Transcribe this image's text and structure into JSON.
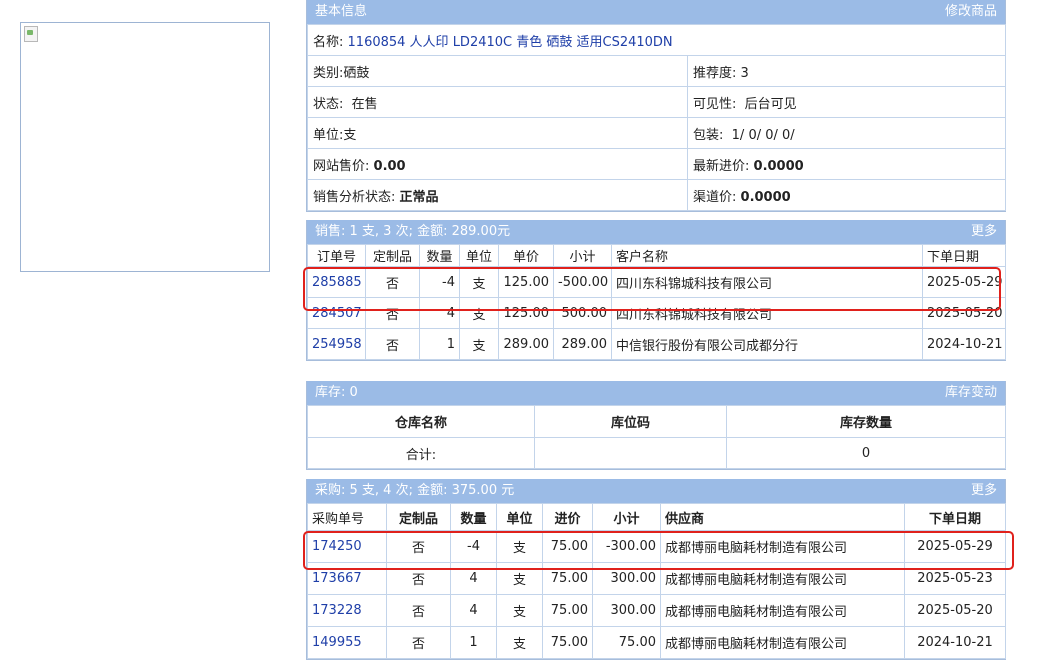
{
  "basic": {
    "header": "基本信息",
    "edit_link": "修改商品",
    "name_label": "名称:",
    "name_value": "1160854 人人印 LD2410C 青色 硒鼓 适用CS2410DN",
    "category_label": "类别:",
    "category_value": "硒鼓",
    "recommend_label": "推荐度:",
    "recommend_value": "3",
    "status_label": "状态:",
    "status_value": "在售",
    "visibility_label": "可见性:",
    "visibility_value": "后台可见",
    "unit_label": "单位:",
    "unit_value": "支",
    "package_label": "包装:",
    "package_value": "1/ 0/ 0/ 0/",
    "web_price_label": "网站售价:",
    "web_price_value": "0.00",
    "latest_cost_label": "最新进价:",
    "latest_cost_value": "0.0000",
    "analysis_label": "销售分析状态:",
    "analysis_value": "正常品",
    "channel_price_label": "渠道价:",
    "channel_price_value": "0.0000"
  },
  "sales": {
    "header": "销售: 1 支, 3 次; 金额: 289.00元",
    "more_link": "更多",
    "columns": [
      "订单号",
      "定制品",
      "数量",
      "单位",
      "单价",
      "小计",
      "客户名称",
      "下单日期"
    ],
    "rows": [
      {
        "order": "285885",
        "custom": "否",
        "qty": "-4",
        "unit": "支",
        "price": "125.00",
        "subtotal": "-500.00",
        "customer": "四川东科锦城科技有限公司",
        "date": "2025-05-29"
      },
      {
        "order": "284507",
        "custom": "否",
        "qty": "4",
        "unit": "支",
        "price": "125.00",
        "subtotal": "500.00",
        "customer": "四川东科锦城科技有限公司",
        "date": "2025-05-20"
      },
      {
        "order": "254958",
        "custom": "否",
        "qty": "1",
        "unit": "支",
        "price": "289.00",
        "subtotal": "289.00",
        "customer": "中信银行股份有限公司成都分行",
        "date": "2024-10-21"
      }
    ]
  },
  "stock": {
    "header": "库存: 0",
    "change_link": "库存变动",
    "columns": [
      "仓库名称",
      "库位码",
      "库存数量"
    ],
    "total_label": "合计:",
    "total_value": "0"
  },
  "purchase": {
    "header": "采购: 5 支, 4 次; 金额: 375.00 元",
    "more_link": "更多",
    "columns": [
      "采购单号",
      "定制品",
      "数量",
      "单位",
      "进价",
      "小计",
      "供应商",
      "下单日期"
    ],
    "rows": [
      {
        "order": "174250",
        "custom": "否",
        "qty": "-4",
        "unit": "支",
        "price": "75.00",
        "subtotal": "-300.00",
        "supplier": "成都博丽电脑耗材制造有限公司",
        "date": "2025-05-29"
      },
      {
        "order": "173667",
        "custom": "否",
        "qty": "4",
        "unit": "支",
        "price": "75.00",
        "subtotal": "300.00",
        "supplier": "成都博丽电脑耗材制造有限公司",
        "date": "2025-05-23"
      },
      {
        "order": "173228",
        "custom": "否",
        "qty": "4",
        "unit": "支",
        "price": "75.00",
        "subtotal": "300.00",
        "supplier": "成都博丽电脑耗材制造有限公司",
        "date": "2025-05-20"
      },
      {
        "order": "149955",
        "custom": "否",
        "qty": "1",
        "unit": "支",
        "price": "75.00",
        "subtotal": "75.00",
        "supplier": "成都博丽电脑耗材制造有限公司",
        "date": "2024-10-21"
      }
    ]
  },
  "colors": {
    "panel_header": "#9bbbe6",
    "link": "#1f3fa8",
    "highlight": "#e0211c"
  },
  "icons": {
    "product_image": "broken-image-icon"
  }
}
